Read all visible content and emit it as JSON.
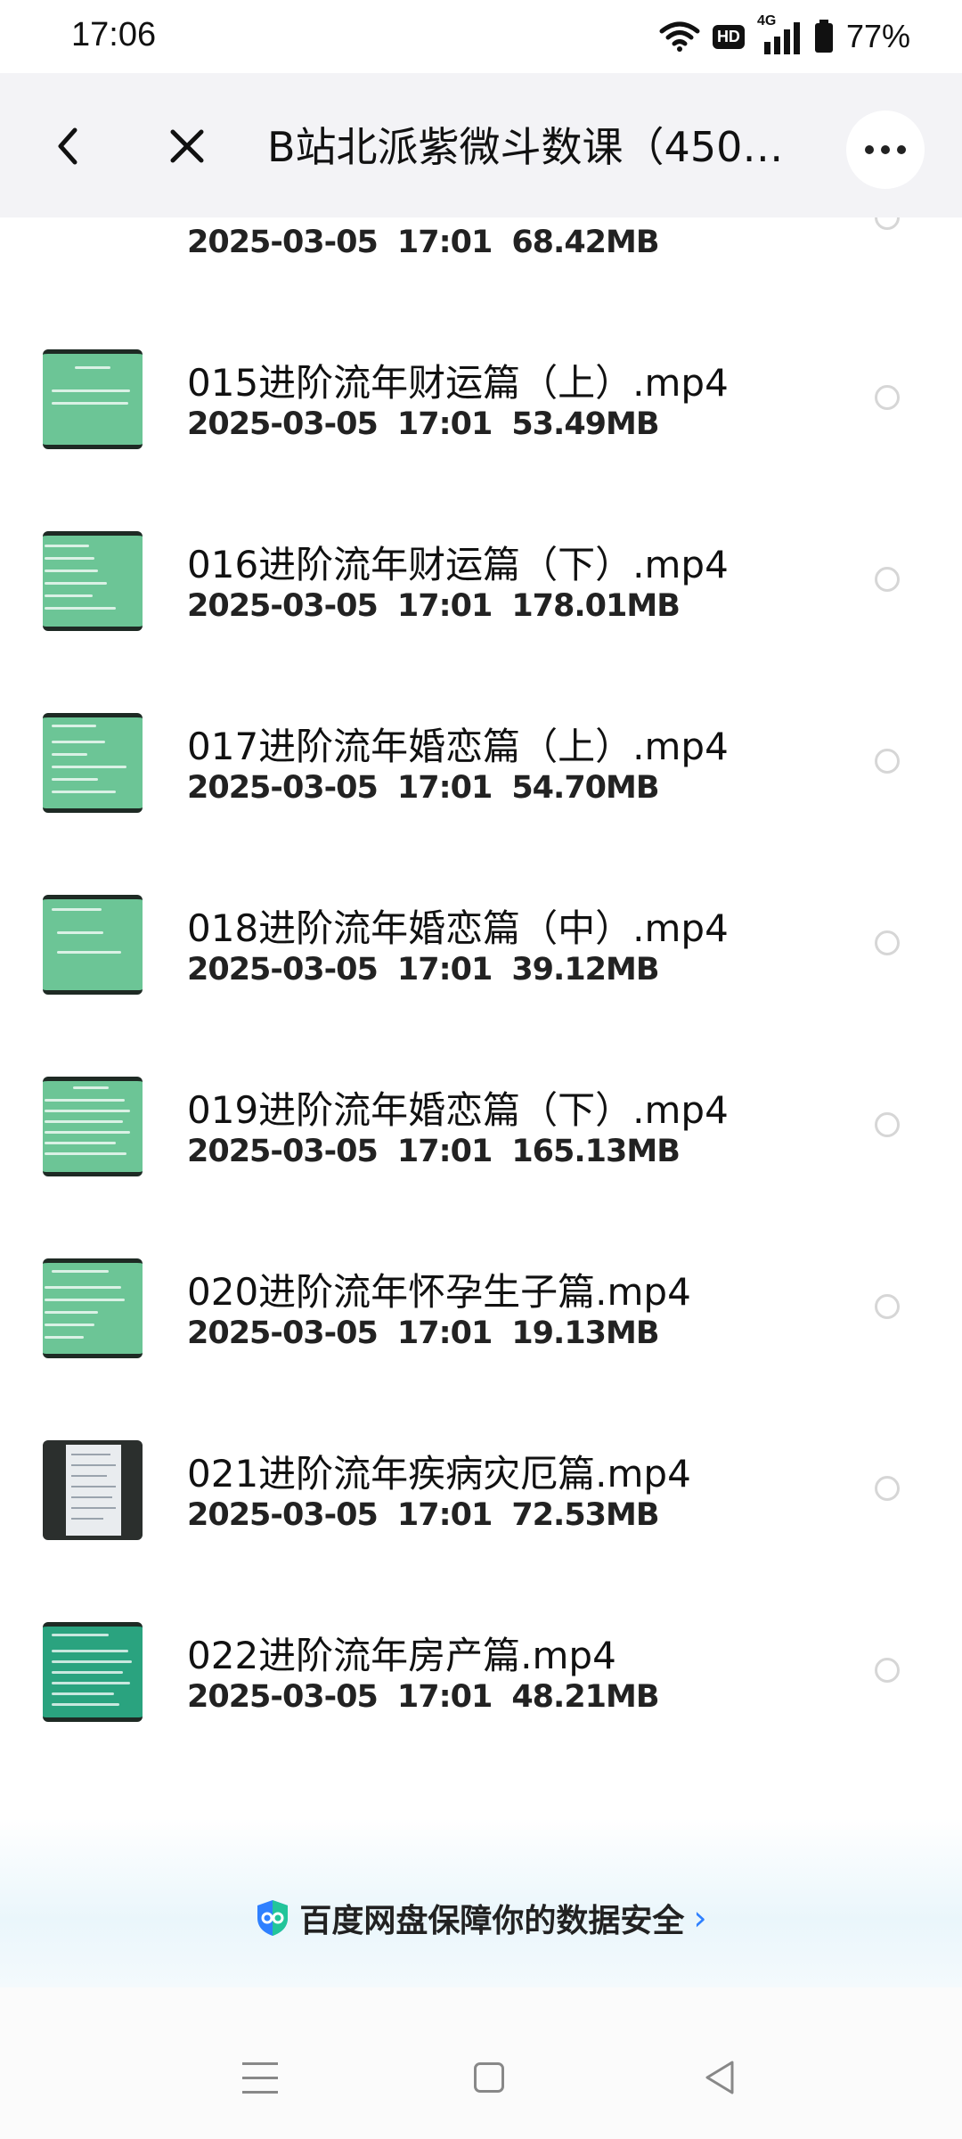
{
  "status_bar": {
    "time": "17:06",
    "hd": "HD",
    "network": "4G",
    "battery": "77%"
  },
  "header": {
    "title": "B站北派紫微斗数课（450…",
    "back_icon": "chevron-left-icon",
    "close_icon": "close-icon",
    "more_icon": "more-dots-icon"
  },
  "files": [
    {
      "name": "",
      "date": "2025-03-05",
      "time": "17:01",
      "size": "68.42MB"
    },
    {
      "name": "015进阶流年财运篇（上）.mp4",
      "date": "2025-03-05",
      "time": "17:01",
      "size": "53.49MB"
    },
    {
      "name": "016进阶流年财运篇（下）.mp4",
      "date": "2025-03-05",
      "time": "17:01",
      "size": "178.01MB"
    },
    {
      "name": "017进阶流年婚恋篇（上）.mp4",
      "date": "2025-03-05",
      "time": "17:01",
      "size": "54.70MB"
    },
    {
      "name": "018进阶流年婚恋篇（中）.mp4",
      "date": "2025-03-05",
      "time": "17:01",
      "size": "39.12MB"
    },
    {
      "name": "019进阶流年婚恋篇（下）.mp4",
      "date": "2025-03-05",
      "time": "17:01",
      "size": "165.13MB"
    },
    {
      "name": "020进阶流年怀孕生子篇.mp4",
      "date": "2025-03-05",
      "time": "17:01",
      "size": "19.13MB"
    },
    {
      "name": "021进阶流年疾病灾厄篇.mp4",
      "date": "2025-03-05",
      "time": "17:01",
      "size": "72.53MB"
    },
    {
      "name": "022进阶流年房产篇.mp4",
      "date": "2025-03-05",
      "time": "17:01",
      "size": "48.21MB"
    }
  ],
  "footer": {
    "security_text": "百度网盘保障你的数据安全",
    "security_icon": "shield-icon"
  },
  "nav": {
    "menu_icon": "menu-icon",
    "home_icon": "home-icon",
    "back_icon": "back-triangle-icon"
  }
}
